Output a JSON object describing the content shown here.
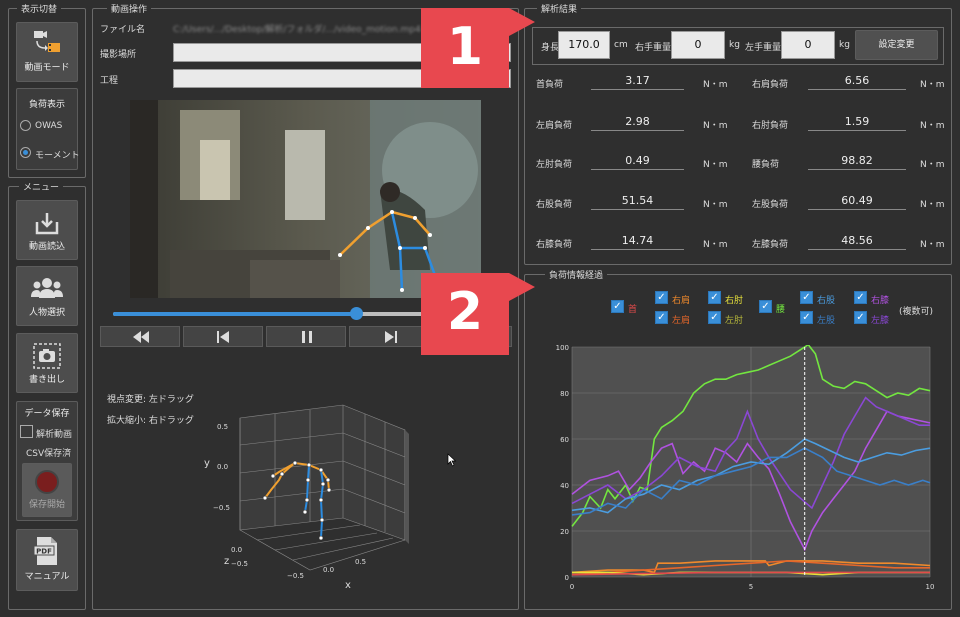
{
  "display_group": {
    "title": "表示切替",
    "video_mode": "動画モード",
    "load_display": "負荷表示",
    "owas": "OWAS",
    "moment": "モーメント"
  },
  "menu_group": {
    "title": "メニュー",
    "read_video": "動画読込",
    "person_select": "人物選択",
    "export": "書き出し",
    "data_save": "データ保存",
    "analysis_video": "解析動画",
    "csv_saved": "CSV保存済",
    "save_start": "保存開始",
    "manual": "マニュアル"
  },
  "video_group": {
    "title": "動画操作",
    "file_name_label": "ファイル名",
    "shoot_place_label": "撮影場所",
    "process_label": "工程",
    "file_name_value": "C:/Users/.../Desktop/解析/フォルダ/.../video_motion.mp4",
    "progress": 0.62,
    "view_change": "視点変更: 左ドラッグ",
    "zoom": "拡大縮小: 右ドラッグ",
    "axis_y": "y",
    "axis_z": "z",
    "axis_x": "x",
    "y_ticks": [
      "0.5",
      "0.0",
      "−0.5"
    ],
    "z_ticks": [
      "0.0",
      "−0.5"
    ],
    "x_ticks": [
      "−0.5",
      "0.0",
      "0.5"
    ]
  },
  "analysis": {
    "title": "解析結果",
    "height_label": "身長",
    "height_value": "170.0",
    "height_unit": "cm",
    "right_weight_label": "右手重量",
    "right_weight_value": "0",
    "right_weight_unit": "kg",
    "left_weight_label": "左手重量",
    "left_weight_value": "0",
    "left_weight_unit": "kg",
    "settings_button": "設定変更",
    "unit": "N・m",
    "rows": [
      {
        "l_label": "首負荷",
        "l_value": "3.17",
        "r_label": "右肩負荷",
        "r_value": "6.56"
      },
      {
        "l_label": "左肩負荷",
        "l_value": "2.98",
        "r_label": "右肘負荷",
        "r_value": "1.59"
      },
      {
        "l_label": "左肘負荷",
        "l_value": "0.49",
        "r_label": "腰負荷",
        "r_value": "98.82"
      },
      {
        "l_label": "右股負荷",
        "l_value": "51.54",
        "r_label": "左股負荷",
        "r_value": "60.49"
      },
      {
        "l_label": "右膝負荷",
        "l_value": "14.74",
        "r_label": "左膝負荷",
        "r_value": "48.56"
      }
    ]
  },
  "load_progress": {
    "title": "負荷情報経過",
    "multi": "(複数可)",
    "checkboxes": [
      {
        "label": "首",
        "color": "#e24b4b"
      },
      {
        "label": "右肩",
        "color": "#f08a2c"
      },
      {
        "label": "左肩",
        "color": "#e6672a"
      },
      {
        "label": "右肘",
        "color": "#e8e23a"
      },
      {
        "label": "左肘",
        "color": "#b7b83a"
      },
      {
        "label": "腰",
        "color": "#73e640"
      },
      {
        "label": "右股",
        "color": "#4b9de0"
      },
      {
        "label": "左股",
        "color": "#3a7fc8"
      },
      {
        "label": "右膝",
        "color": "#b052e0"
      },
      {
        "label": "左膝",
        "color": "#8a47d4"
      }
    ]
  },
  "badges": {
    "one": "1",
    "two": "2"
  },
  "chart_data": {
    "type": "line",
    "xlim": [
      0,
      10
    ],
    "ylim": [
      0,
      100
    ],
    "x_ticks": [
      "0",
      "5",
      "10"
    ],
    "y_ticks": [
      "0",
      "20",
      "40",
      "60",
      "80",
      "100"
    ],
    "cursor_x": 6.5,
    "series": [
      {
        "name": "腰",
        "color": "#73e640",
        "x": [
          0,
          0.3,
          0.5,
          0.8,
          1.0,
          1.2,
          1.5,
          1.7,
          1.9,
          2.1,
          2.3,
          2.5,
          2.8,
          3.1,
          3.4,
          3.7,
          4.0,
          4.3,
          4.6,
          4.9,
          5.2,
          5.5,
          5.8,
          6.1,
          6.4,
          6.6,
          6.8,
          7.0,
          7.3,
          7.6,
          7.9,
          8.2,
          8.5,
          8.8,
          9.1,
          9.4,
          9.7,
          10
        ],
        "y": [
          22,
          28,
          35,
          30,
          38,
          34,
          40,
          33,
          39,
          38,
          60,
          65,
          68,
          72,
          80,
          84,
          86,
          86,
          88,
          89,
          90,
          92,
          94,
          96,
          99,
          101,
          97,
          86,
          83,
          82,
          85,
          84,
          81,
          78,
          80,
          79,
          82,
          81
        ]
      },
      {
        "name": "右膝",
        "color": "#b052e0",
        "x": [
          0,
          0.5,
          1,
          1.3,
          1.6,
          1.9,
          2.2,
          2.5,
          2.8,
          3.1,
          3.4,
          3.7,
          4.0,
          4.3,
          4.6,
          4.9,
          5.2,
          5.5,
          5.8,
          6.1,
          6.3,
          6.5,
          6.7,
          7.0,
          7.3,
          7.6,
          7.9,
          8.2,
          8.5,
          8.8,
          9.1,
          9.4,
          9.7,
          10
        ],
        "y": [
          36,
          42,
          44,
          46,
          38,
          43,
          50,
          56,
          58,
          45,
          50,
          46,
          56,
          54,
          50,
          58,
          52,
          47,
          36,
          24,
          18,
          12,
          20,
          28,
          34,
          40,
          46,
          56,
          64,
          72,
          70,
          69,
          68,
          67
        ]
      },
      {
        "name": "左膝",
        "color": "#8a47d4",
        "x": [
          0,
          0.5,
          1,
          1.5,
          2.0,
          2.5,
          3.0,
          3.5,
          4.0,
          4.3,
          4.6,
          4.9,
          5.2,
          5.5,
          5.8,
          6.1,
          6.4,
          6.7,
          7.0,
          7.3,
          7.6,
          7.9,
          8.2,
          8.5,
          8.8,
          9.1,
          9.4,
          9.7,
          10
        ],
        "y": [
          32,
          36,
          40,
          34,
          38,
          44,
          52,
          48,
          46,
          55,
          60,
          72,
          60,
          52,
          45,
          38,
          34,
          30,
          40,
          50,
          62,
          70,
          78,
          74,
          72,
          70,
          68,
          66,
          66
        ]
      },
      {
        "name": "右股",
        "color": "#4b9de0",
        "x": [
          0,
          0.5,
          1,
          1.5,
          2,
          2.5,
          3,
          3.5,
          4,
          4.5,
          5,
          5.5,
          6,
          6.5,
          6.8,
          7.2,
          7.6,
          8,
          8.4,
          8.8,
          9.2,
          9.6,
          10
        ],
        "y": [
          29,
          30,
          28,
          34,
          36,
          40,
          38,
          42,
          44,
          48,
          50,
          49,
          54,
          60,
          58,
          55,
          52,
          50,
          52,
          54,
          53,
          55,
          56
        ]
      },
      {
        "name": "左股",
        "color": "#3a7fc8",
        "x": [
          0,
          0.5,
          1,
          1.5,
          2,
          2.5,
          3,
          3.5,
          4,
          4.5,
          5,
          5.5,
          6,
          6.5,
          7,
          7.4,
          7.8,
          8.2,
          8.6,
          9,
          9.4,
          9.8,
          10
        ],
        "y": [
          27,
          28,
          32,
          30,
          38,
          34,
          42,
          40,
          44,
          46,
          48,
          52,
          52,
          56,
          52,
          46,
          44,
          42,
          40,
          42,
          40,
          42,
          41
        ]
      },
      {
        "name": "右肩",
        "color": "#f08a2c",
        "x": [
          0,
          1,
          2,
          2.3,
          2.4,
          3,
          4,
          5,
          5.4,
          5.5,
          6,
          6.5,
          7,
          8,
          9,
          10
        ],
        "y": [
          2,
          3,
          3,
          2,
          6,
          6,
          7,
          7,
          7,
          5,
          7,
          7,
          7,
          6,
          6,
          5
        ]
      },
      {
        "name": "左肩",
        "color": "#e6672a",
        "x": [
          0,
          1,
          2,
          3,
          4,
          5,
          6,
          7,
          8,
          9,
          10
        ],
        "y": [
          1,
          2,
          3,
          4,
          5,
          6,
          7,
          6,
          5,
          4,
          4
        ]
      },
      {
        "name": "右肘",
        "color": "#e8e23a",
        "x": [
          0,
          1,
          2,
          3,
          4,
          5,
          6,
          7,
          8,
          9,
          10
        ],
        "y": [
          2,
          2,
          1,
          2,
          2,
          2,
          2,
          1,
          2,
          2,
          2
        ]
      },
      {
        "name": "首",
        "color": "#e24b4b",
        "x": [
          0,
          2,
          4,
          6,
          8,
          10
        ],
        "y": [
          1,
          1.5,
          2,
          2,
          2,
          2
        ]
      }
    ]
  }
}
